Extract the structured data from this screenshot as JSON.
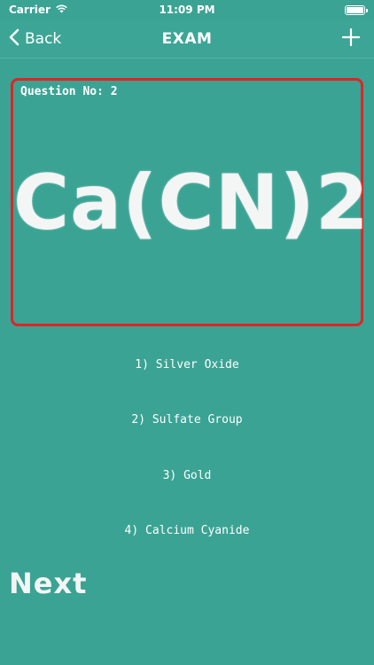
{
  "status_bar": {
    "carrier": "Carrier",
    "time": "11:09 PM"
  },
  "nav": {
    "back_label": "Back",
    "title": "EXAM",
    "add_icon": "plus-icon"
  },
  "question": {
    "number_label": "Question No: 2",
    "formula": "Ca(CN)2"
  },
  "options": [
    {
      "label": "1) Silver Oxide"
    },
    {
      "label": "2) Sulfate Group"
    },
    {
      "label": "3) Gold"
    },
    {
      "label": "4) Calcium Cyanide"
    }
  ],
  "next_label": "Next",
  "colors": {
    "background": "#3aa394",
    "card_border": "#e02424",
    "text": "#ffffff"
  }
}
